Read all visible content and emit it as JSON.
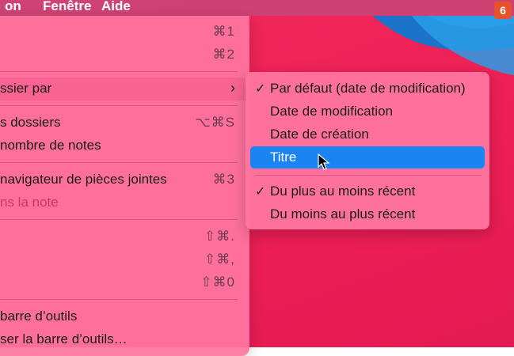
{
  "menubar": {
    "items": [
      "on",
      "Fenêtre",
      "Aide"
    ],
    "badge": "6"
  },
  "menu": {
    "rows": [
      {
        "label": "",
        "shortcut": "⌘1"
      },
      {
        "label": "",
        "shortcut": "⌘2"
      },
      {
        "label": "ssier par",
        "shortcut": "",
        "submenu_arrow": "›"
      },
      {
        "label": "s dossiers",
        "shortcut": "⌥⌘S"
      },
      {
        "label": "nombre de notes",
        "shortcut": ""
      },
      {
        "label": "navigateur de pièces jointes",
        "shortcut": "⌘3"
      },
      {
        "label": "ns la note",
        "shortcut": ""
      },
      {
        "label": "",
        "shortcut": "⇧⌘."
      },
      {
        "label": "",
        "shortcut": "⇧⌘,"
      },
      {
        "label": "",
        "shortcut": "⇧⌘0"
      },
      {
        "label": "barre d’outils",
        "shortcut": ""
      },
      {
        "label": "ser la barre d’outils…",
        "shortcut": ""
      }
    ]
  },
  "submenu": {
    "items": [
      {
        "label": "Par défaut (date de modification)",
        "checked": true
      },
      {
        "label": "Date de modification",
        "checked": false
      },
      {
        "label": "Date de création",
        "checked": false
      },
      {
        "label": "Titre",
        "checked": false,
        "selected": true
      },
      {
        "label": "Du plus au moins récent",
        "checked": true
      },
      {
        "label": "Du moins au plus récent",
        "checked": false
      }
    ],
    "check_glyph": "✓"
  },
  "colors": {
    "menu_bg": "#ff76a0",
    "selection": "#1a84f3",
    "wallpaper": "#ee1f55",
    "badge": "#e8522a"
  }
}
